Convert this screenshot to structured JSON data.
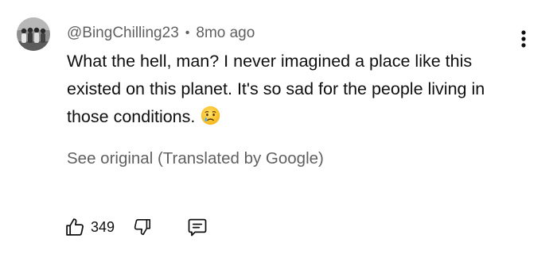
{
  "comment": {
    "author": "@BingChilling23",
    "separator": "•",
    "timestamp": "8mo ago",
    "text": "What the hell, man? I never imagined a place like this existed on this planet. It's so sad for the people living in those conditions.",
    "emoji_icon": "crying-face-emoji",
    "translation_link": "See original (Translated by Google)",
    "like_count": "349"
  },
  "icons": {
    "menu": "more-vertical-icon",
    "like": "thumbs-up-icon",
    "dislike": "thumbs-down-icon",
    "reply": "comment-icon"
  },
  "colors": {
    "text_primary": "#0f0f0f",
    "text_secondary": "#606060",
    "background": "#ffffff"
  }
}
